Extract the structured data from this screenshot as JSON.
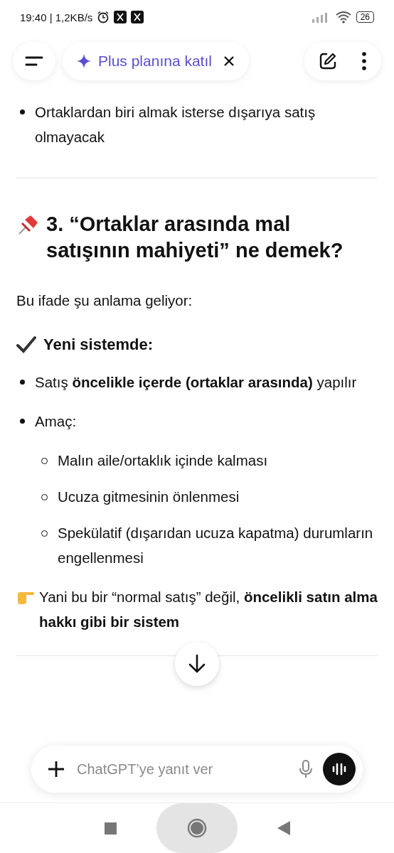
{
  "status_bar": {
    "time": "19:40 | 1,2KB/s",
    "battery": "26"
  },
  "header": {
    "upgrade_label": "Plus planına katıl"
  },
  "content": [
    {
      "kind": "bullet",
      "text": "Ortaklardan biri almak isterse dışarıya satış olmayacak"
    },
    {
      "kind": "divider"
    },
    {
      "kind": "heading",
      "text": "3. “Ortaklar arasında mal satışının mahiyeti” ne demek?"
    },
    {
      "kind": "paragraph",
      "text": "Bu ifade şu anlama geliyor:"
    },
    {
      "kind": "subheading",
      "text": "Yeni sistemde:"
    },
    {
      "kind": "bullet",
      "text": "Satış **öncelikle içerde (ortaklar arasında)** yapılır"
    },
    {
      "kind": "bullet",
      "text": "Amaç:",
      "children": [
        {
          "text": "Malın aile/ortaklık içinde kalması"
        },
        {
          "text": "Ucuza gitmesinin önlenmesi"
        },
        {
          "text": "Spekülatif (dışarıdan ucuza kapatma) durumların engellenmesi"
        }
      ]
    },
    {
      "kind": "note",
      "text": "Yani bu bir “normal satış” değil, **öncelikli satın alma hakkı gibi bir sistem**"
    },
    {
      "kind": "divider"
    }
  ],
  "composer": {
    "placeholder": "ChatGPT’ye yanıt ver"
  }
}
